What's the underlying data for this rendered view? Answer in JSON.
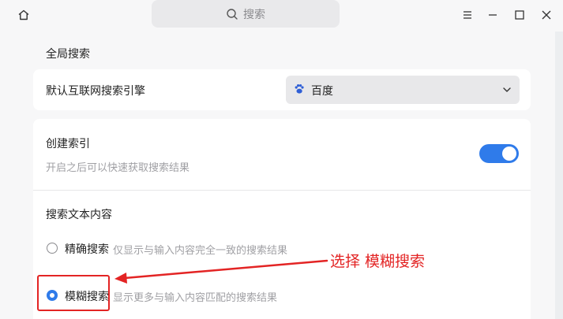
{
  "titlebar": {
    "search_placeholder": "搜索",
    "icons": [
      "home-icon",
      "search-icon",
      "menu-icon",
      "minimize-icon",
      "maximize-icon",
      "close-icon"
    ]
  },
  "global_search": {
    "title": "全局搜索"
  },
  "engine": {
    "label": "默认互联网搜索引擎",
    "selected": "百度",
    "icon": "baidu-paw-icon"
  },
  "index": {
    "label": "创建索引",
    "hint": "开启之后可以快速获取搜索结果",
    "enabled": true
  },
  "text_content": {
    "label": "搜索文本内容",
    "options": [
      {
        "label": "精确搜索",
        "hint": "仅显示与输入内容完全一致的搜索结果",
        "selected": false
      },
      {
        "label": "模糊搜索",
        "hint": "显示更多与输入内容匹配的搜索结果",
        "selected": true
      }
    ]
  },
  "annotation": {
    "text": "选择 模糊搜索",
    "color": "#e32424"
  },
  "colors": {
    "accent": "#2f7bea",
    "annotation": "#e32424"
  }
}
